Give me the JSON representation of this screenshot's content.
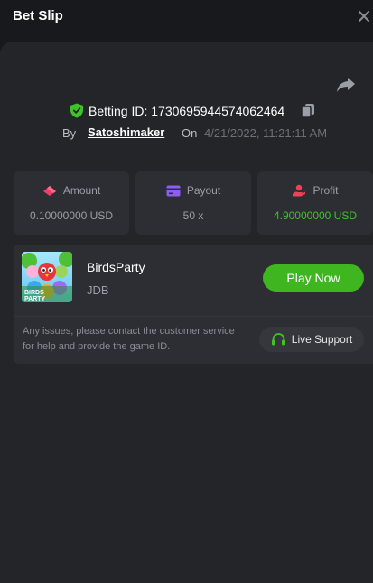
{
  "header": {
    "title": "Bet Slip",
    "close_icon": "close-icon"
  },
  "bet": {
    "betting_id_label": "Betting ID: 1730695944574062464",
    "by_label": "By",
    "username": "Satoshimaker",
    "on_label": "On",
    "date": "4/21/2022, 11:21:11 AM"
  },
  "stats": [
    {
      "label": "Amount",
      "value": "0.10000000 USD",
      "icon": "wager-icon"
    },
    {
      "label": "Payout",
      "value": "50 x",
      "icon": "card-icon"
    },
    {
      "label": "Profit",
      "value": "4.90000000 USD",
      "icon": "profit-icon"
    }
  ],
  "game": {
    "name": "BirdsParty",
    "provider": "JDB",
    "play_label": "Play Now",
    "thumb_text_1": "BIRDS",
    "thumb_text_2": "PARTY",
    "issues_text": "Any issues, please contact the customer service for help and provide the game ID.",
    "support_label": "Live Support"
  },
  "colors": {
    "accent_green": "#3fb620",
    "profit_green": "#3fc22a",
    "background": "#18191c",
    "panel": "#232529",
    "card": "#2c2e33"
  }
}
